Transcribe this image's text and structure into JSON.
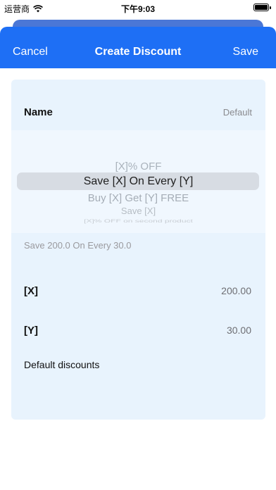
{
  "status_bar": {
    "carrier": "运营商",
    "time": "下午9:03"
  },
  "nav": {
    "cancel_label": "Cancel",
    "title": "Create Discount",
    "save_label": "Save"
  },
  "form": {
    "name_label": "Name",
    "name_value": "Default",
    "picker_options": [
      "[X]% OFF",
      "Save [X] On Every [Y]",
      "Buy [X] Get [Y] FREE",
      "Save [X]",
      "[X]% OFF on second product"
    ],
    "summary": "Save 200.0 On Every 30.0",
    "x_label": "[X]",
    "x_value": "200.00",
    "y_label": "[Y]",
    "y_value": "30.00",
    "default_discounts_label": "Default discounts"
  },
  "colors": {
    "accent": "#1e6ff5",
    "card_background": "#e8f3fd"
  }
}
